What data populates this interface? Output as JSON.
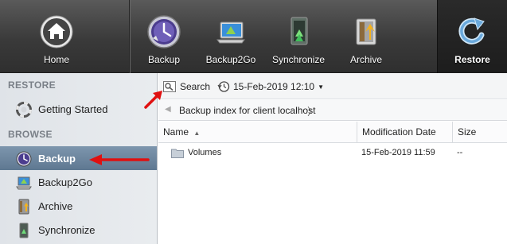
{
  "toolbar": {
    "items": [
      {
        "label": "Home",
        "icon": "home-icon"
      },
      {
        "label": "Backup",
        "icon": "backup-clock-icon"
      },
      {
        "label": "Backup2Go",
        "icon": "laptop-icon"
      },
      {
        "label": "Synchronize",
        "icon": "sync-icon"
      },
      {
        "label": "Archive",
        "icon": "archive-icon"
      },
      {
        "label": "Restore",
        "icon": "restore-icon"
      }
    ],
    "active": "Restore"
  },
  "sidebar": {
    "restore_heading": "RESTORE",
    "browse_heading": "BROWSE",
    "items": [
      {
        "label": "Getting Started",
        "icon": "lifebuoy-icon"
      },
      {
        "label": "Backup",
        "icon": "backup-clock-icon",
        "active": true
      },
      {
        "label": "Backup2Go",
        "icon": "laptop-icon"
      },
      {
        "label": "Archive",
        "icon": "archive-icon"
      },
      {
        "label": "Synchronize",
        "icon": "sync-icon"
      }
    ]
  },
  "main": {
    "search_label": "Search",
    "date_label": "15-Feb-2019 12:10",
    "breadcrumb": "Backup index for client localhost",
    "columns": [
      "Name",
      "Modification Date",
      "Size"
    ],
    "rows": [
      {
        "name": "Volumes",
        "modified": "15-Feb-2019 11:59",
        "size": "--"
      }
    ]
  },
  "colors": {
    "toolbar_bg": "#3a3a3a",
    "sidebar_active": "#6a849c",
    "annotation_arrow": "#e01010"
  }
}
